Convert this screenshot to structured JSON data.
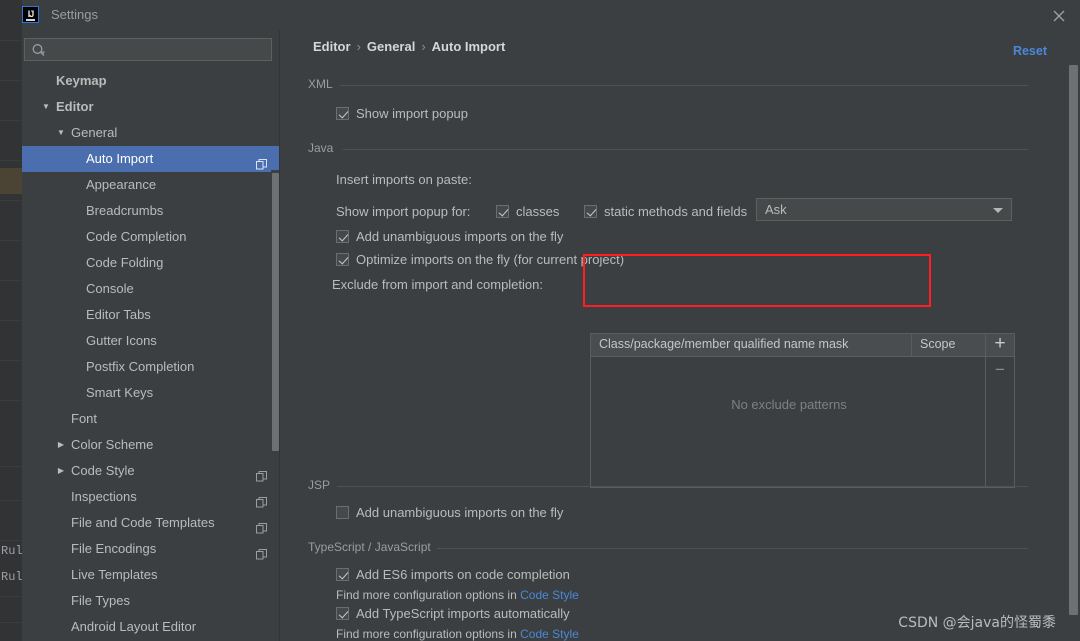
{
  "window": {
    "title": "Settings",
    "app_icon": "intellij-idea-icon",
    "close_icon": "close-icon"
  },
  "sidebar": {
    "search": {
      "value": "",
      "placeholder": "",
      "icon": "search-icon"
    },
    "items": [
      {
        "label": "Keymap",
        "level": 0,
        "arrow": "",
        "bold": true,
        "selected": false,
        "copy": false
      },
      {
        "label": "Editor",
        "level": 0,
        "arrow": "▼",
        "bold": true,
        "selected": false,
        "copy": false
      },
      {
        "label": "General",
        "level": 1,
        "arrow": "▼",
        "bold": false,
        "selected": false,
        "copy": false
      },
      {
        "label": "Auto Import",
        "level": 2,
        "arrow": "",
        "bold": false,
        "selected": true,
        "copy": true
      },
      {
        "label": "Appearance",
        "level": 2,
        "arrow": "",
        "bold": false,
        "selected": false,
        "copy": false
      },
      {
        "label": "Breadcrumbs",
        "level": 2,
        "arrow": "",
        "bold": false,
        "selected": false,
        "copy": false
      },
      {
        "label": "Code Completion",
        "level": 2,
        "arrow": "",
        "bold": false,
        "selected": false,
        "copy": false
      },
      {
        "label": "Code Folding",
        "level": 2,
        "arrow": "",
        "bold": false,
        "selected": false,
        "copy": false
      },
      {
        "label": "Console",
        "level": 2,
        "arrow": "",
        "bold": false,
        "selected": false,
        "copy": false
      },
      {
        "label": "Editor Tabs",
        "level": 2,
        "arrow": "",
        "bold": false,
        "selected": false,
        "copy": false
      },
      {
        "label": "Gutter Icons",
        "level": 2,
        "arrow": "",
        "bold": false,
        "selected": false,
        "copy": false
      },
      {
        "label": "Postfix Completion",
        "level": 2,
        "arrow": "",
        "bold": false,
        "selected": false,
        "copy": false
      },
      {
        "label": "Smart Keys",
        "level": 2,
        "arrow": "",
        "bold": false,
        "selected": false,
        "copy": false
      },
      {
        "label": "Font",
        "level": 1,
        "arrow": "",
        "bold": false,
        "selected": false,
        "copy": false
      },
      {
        "label": "Color Scheme",
        "level": 1,
        "arrow": "▶",
        "bold": false,
        "selected": false,
        "copy": false
      },
      {
        "label": "Code Style",
        "level": 1,
        "arrow": "▶",
        "bold": false,
        "selected": false,
        "copy": true
      },
      {
        "label": "Inspections",
        "level": 1,
        "arrow": "",
        "bold": false,
        "selected": false,
        "copy": true
      },
      {
        "label": "File and Code Templates",
        "level": 1,
        "arrow": "",
        "bold": false,
        "selected": false,
        "copy": true
      },
      {
        "label": "File Encodings",
        "level": 1,
        "arrow": "",
        "bold": false,
        "selected": false,
        "copy": true
      },
      {
        "label": "Live Templates",
        "level": 1,
        "arrow": "",
        "bold": false,
        "selected": false,
        "copy": false
      },
      {
        "label": "File Types",
        "level": 1,
        "arrow": "",
        "bold": false,
        "selected": false,
        "copy": false
      },
      {
        "label": "Android Layout Editor",
        "level": 1,
        "arrow": "",
        "bold": false,
        "selected": false,
        "copy": false
      }
    ]
  },
  "main": {
    "breadcrumb": {
      "part1": "Editor",
      "part2": "General",
      "part3": "Auto Import",
      "separator": "›"
    },
    "reset_label": "Reset",
    "sections": {
      "xml": {
        "title": "XML",
        "show_import_popup": {
          "label": "Show import popup",
          "checked": true
        }
      },
      "java": {
        "title": "Java",
        "insert_imports_label": "Insert imports on paste:",
        "insert_imports_value": "Ask",
        "show_import_popup_for_label": "Show import popup for:",
        "classes": {
          "label": "classes",
          "checked": true
        },
        "static_methods": {
          "label": "static methods and fields",
          "checked": true
        },
        "add_unambiguous": {
          "label": "Add unambiguous imports on the fly",
          "checked": true
        },
        "optimize_imports": {
          "label": "Optimize imports on the fly (for current project)",
          "checked": true
        },
        "exclude_label": "Exclude from import and completion:",
        "table": {
          "columns": [
            "Class/package/member qualified name mask",
            "Scope"
          ],
          "rows": [],
          "empty_text": "No exclude patterns",
          "add_label": "+",
          "remove_label": "−"
        }
      },
      "jsp": {
        "title": "JSP",
        "add_unambiguous": {
          "label": "Add unambiguous imports on the fly",
          "checked": false
        }
      },
      "ts_js": {
        "title": "TypeScript / JavaScript",
        "es6": {
          "label": "Add ES6 imports on code completion",
          "checked": true
        },
        "es6_hint_prefix": "Find more configuration options in ",
        "es6_hint_link": "Code Style",
        "ts_auto": {
          "label": "Add TypeScript imports automatically",
          "checked": true
        },
        "ts_hint_prefix": "Find more configuration options in ",
        "ts_hint_link": "Code Style"
      }
    }
  },
  "watermark": "CSDN @会java的怪蜀黍",
  "colors": {
    "accent_selection": "#4b6eaf",
    "link": "#4a88d8",
    "annotation_red": "#ff1f1f",
    "panel_bg": "#3c3f41",
    "text": "#bbbbbb"
  },
  "background_editor": {
    "snippet1": "Rul",
    "snippet2": "Rul"
  }
}
